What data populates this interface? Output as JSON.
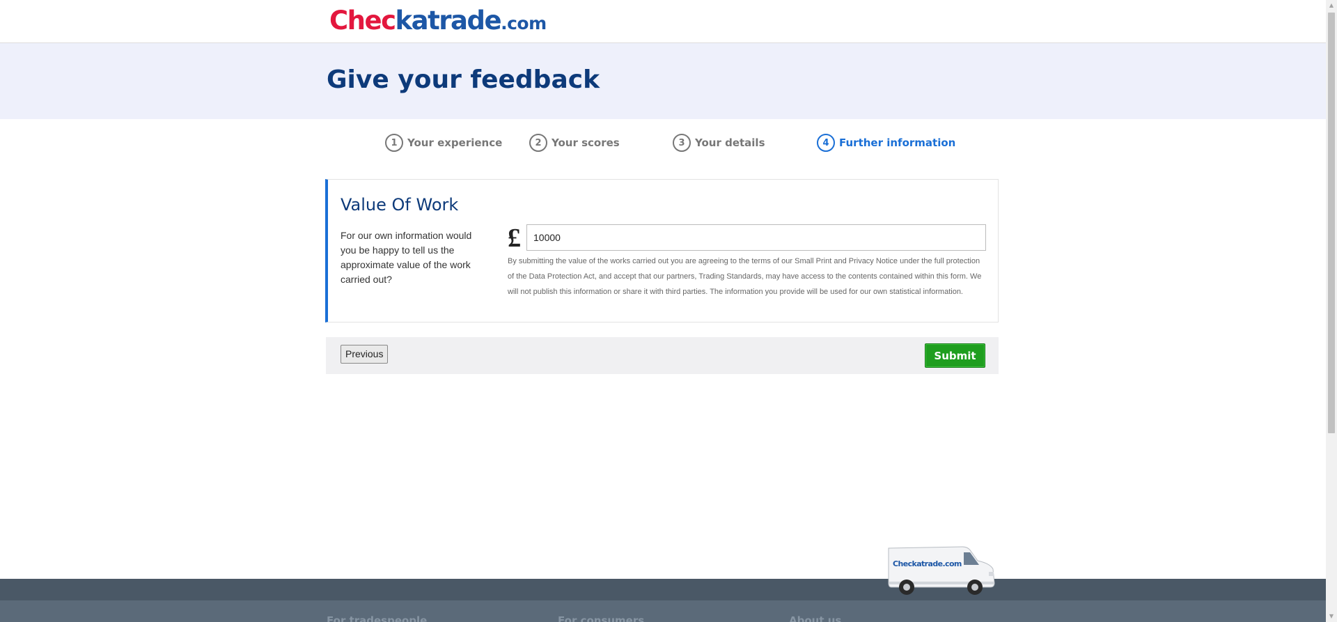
{
  "logo": {
    "part1": "Chec",
    "part2": "katrade",
    "part3": ".com"
  },
  "banner": {
    "title": "Give your feedback"
  },
  "steps": [
    {
      "number": "1",
      "label": "Your experience"
    },
    {
      "number": "2",
      "label": "Your scores"
    },
    {
      "number": "3",
      "label": "Your details"
    },
    {
      "number": "4",
      "label": "Further information"
    }
  ],
  "active_step": 4,
  "card": {
    "title": "Value Of Work",
    "description": "For our own information would you be happy to tell us the approximate value of the work carried out?",
    "currency_symbol": "£",
    "amount_value": "10000",
    "disclaimer": "By submitting the value of the works carried out you are agreeing to the terms of our Small Print and Privacy Notice under the full protection of the Data Protection Act, and accept that our partners, Trading Standards, may have access to the contents contained within this form. We will not publish this information or share it with third parties. The information you provide will be used for our own statistical information."
  },
  "actions": {
    "previous_label": "Previous",
    "submit_label": "Submit"
  },
  "van": {
    "logo_text": "Checkatrade.com"
  },
  "footer": {
    "col1": "For tradespeople",
    "col2": "For consumers",
    "col3": "About us"
  },
  "colors": {
    "brand_red": "#e3173e",
    "brand_blue": "#1d57a6",
    "title_navy": "#0d3a7a",
    "active_blue": "#1a6fd6",
    "submit_green": "#1f9e1f",
    "footer": "#5b6a79"
  }
}
